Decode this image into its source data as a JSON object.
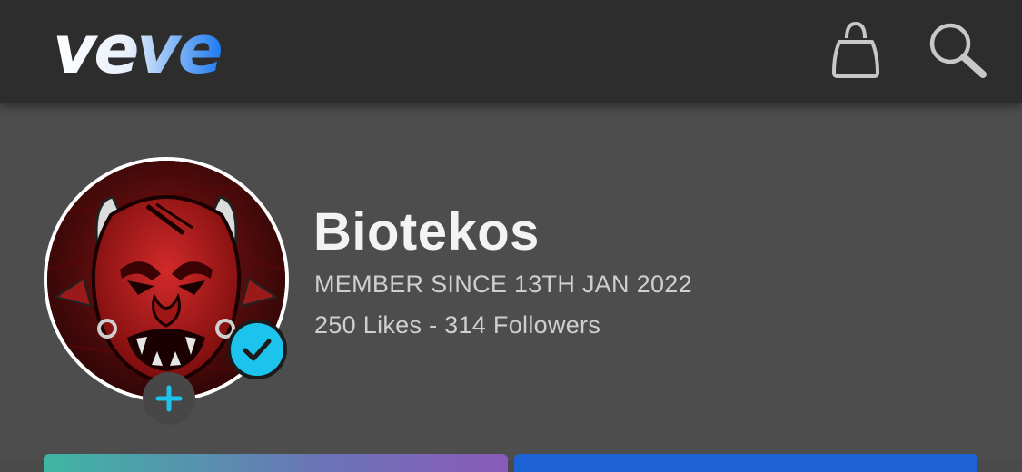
{
  "header": {
    "logo_text": "veve",
    "logo_icon": "veve-logo",
    "bag_icon": "shopping-bag-icon",
    "search_icon": "search-icon"
  },
  "profile": {
    "username": "Biotekos",
    "member_since": "MEMBER SINCE 13TH JAN 2022",
    "stats": "250 Likes - 314 Followers",
    "avatar_icon": "red-demon-avatar",
    "verified_icon": "verified-check-icon",
    "follow_icon": "plus-icon"
  },
  "colors": {
    "header_bg": "#2d2d2d",
    "page_bg": "#4d4d4d",
    "accent": "#1cc3ec",
    "logo_white": "#ffffff",
    "logo_blue": "#1e7bf0"
  }
}
